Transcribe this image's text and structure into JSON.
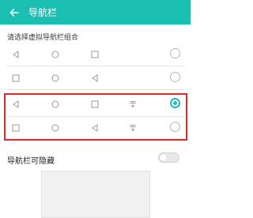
{
  "app_bar": {
    "title": "导航栏",
    "back_icon": "back-arrow-icon",
    "color": "#1bbfb2"
  },
  "section": {
    "title": "请选择虚拟导航栏组合"
  },
  "options": [
    {
      "buttons": [
        "back-icon",
        "home-icon",
        "recent-icon"
      ],
      "selected": false
    },
    {
      "buttons": [
        "recent-icon",
        "home-icon",
        "back-icon"
      ],
      "selected": false
    },
    {
      "buttons": [
        "back-icon",
        "home-icon",
        "recent-icon",
        "notification-pulldown-icon"
      ],
      "selected": true
    },
    {
      "buttons": [
        "recent-icon",
        "home-icon",
        "back-icon",
        "notification-pulldown-icon"
      ],
      "selected": false
    }
  ],
  "hide_option": {
    "label": "导航栏可隐藏",
    "enabled": false
  }
}
